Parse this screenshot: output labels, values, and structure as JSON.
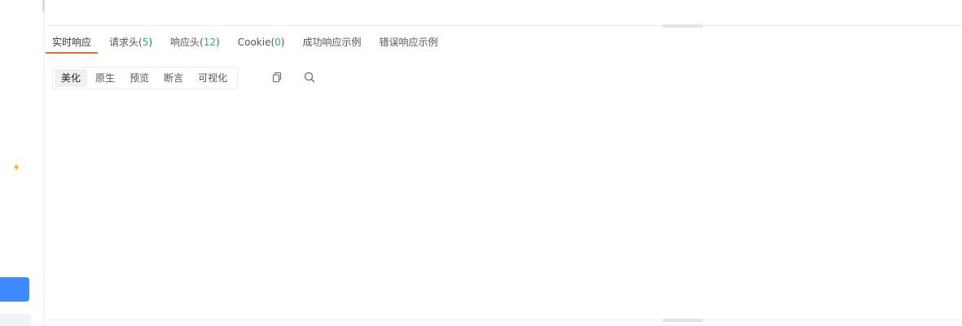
{
  "response_tabs": [
    {
      "label": "实时响应",
      "count": null
    },
    {
      "label": "请求头",
      "count": "5"
    },
    {
      "label": "响应头",
      "count": "12"
    },
    {
      "label": "Cookie",
      "count": "0"
    },
    {
      "label": "成功响应示例",
      "count": null
    },
    {
      "label": "错误响应示例",
      "count": null
    }
  ],
  "view_modes": [
    "美化",
    "原生",
    "预览",
    "断言",
    "可视化"
  ],
  "colors": {
    "accent_underline": "#f06a2a",
    "count_green": "#2fb36b",
    "primary_blue": "#3d8bff",
    "bolt_yellow": "#f5b800"
  },
  "icons": {
    "copy": "copy-icon",
    "search": "search-icon",
    "bolt": "bolt-icon"
  }
}
